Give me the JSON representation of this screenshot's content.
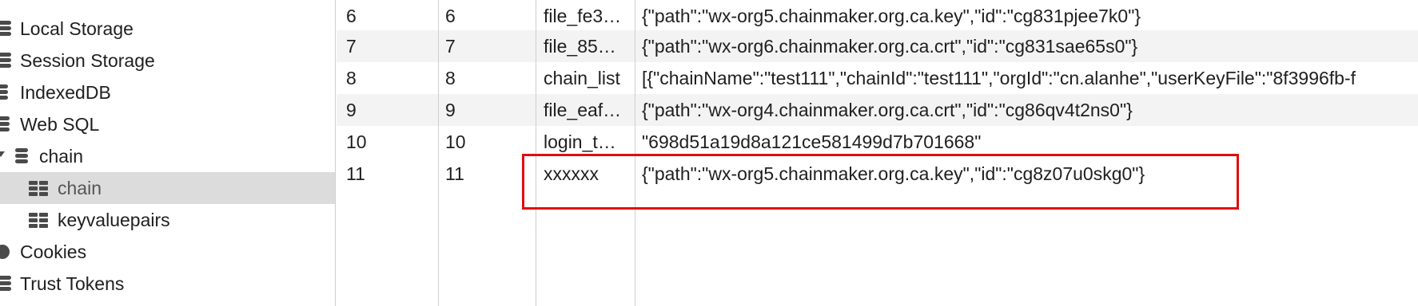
{
  "sidebar": {
    "items": [
      {
        "label": "Local Storage",
        "icon": "database-icon"
      },
      {
        "label": "Session Storage",
        "icon": "database-icon"
      },
      {
        "label": "IndexedDB",
        "icon": "database-icon"
      },
      {
        "label": "Web SQL",
        "icon": "database-icon"
      },
      {
        "label": "chain",
        "icon": "database-icon"
      },
      {
        "label": "chain",
        "icon": "table-icon",
        "selected": true
      },
      {
        "label": "keyvaluepairs",
        "icon": "table-icon"
      },
      {
        "label": "Cookies",
        "icon": "cookie-icon"
      },
      {
        "label": "Trust Tokens",
        "icon": "database-icon"
      }
    ]
  },
  "table": {
    "rows": [
      {
        "c0": "6",
        "c1": "6",
        "c2": "file_fe3…",
        "c3": "{\"path\":\"wx-org5.chainmaker.org.ca.key\",\"id\":\"cg831pjee7k0\"}"
      },
      {
        "c0": "7",
        "c1": "7",
        "c2": "file_85…",
        "c3": "{\"path\":\"wx-org6.chainmaker.org.ca.crt\",\"id\":\"cg831sae65s0\"}"
      },
      {
        "c0": "8",
        "c1": "8",
        "c2": "chain_list",
        "c3": "[{\"chainName\":\"test111\",\"chainId\":\"test111\",\"orgId\":\"cn.alanhe\",\"userKeyFile\":\"8f3996fb-f"
      },
      {
        "c0": "9",
        "c1": "9",
        "c2": "file_eaf…",
        "c3": "{\"path\":\"wx-org4.chainmaker.org.ca.crt\",\"id\":\"cg86qv4t2ns0\"}"
      },
      {
        "c0": "10",
        "c1": "10",
        "c2": "login_t…",
        "c3": "\"698d51a19d8a121ce581499d7b701668\""
      },
      {
        "c0": "11",
        "c1": "11",
        "c2": "xxxxxx",
        "c3": "{\"path\":\"wx-org5.chainmaker.org.ca.key\",\"id\":\"cg8z07u0skg0\"}"
      }
    ]
  },
  "colors": {
    "highlight": "#e10d0d",
    "selected_bg": "#dcdcdc",
    "alt_row_bg": "#f3f3f3"
  }
}
